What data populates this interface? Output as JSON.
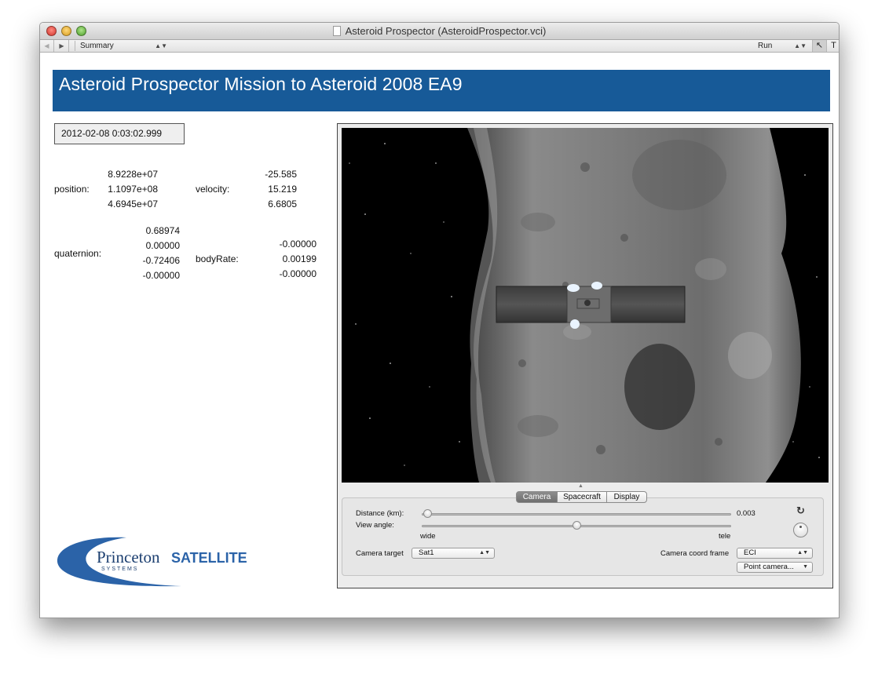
{
  "window": {
    "title": "Asteroid Prospector (AsteroidProspector.vci)"
  },
  "toolbar": {
    "back_glyph": "◀",
    "forward_glyph": "▶",
    "view_popup": "Summary",
    "mode_popup": "Run",
    "arrow_tool": "↖",
    "text_tool": "T"
  },
  "header": {
    "title": "Asteroid Prospector Mission to Asteroid 2008 EA9",
    "background_color": "#175a98"
  },
  "state": {
    "timestamp": "2012-02-08 0:03:02.999",
    "position": {
      "label": "position:",
      "values": [
        "8.9228e+07",
        "1.1097e+08",
        "4.6945e+07"
      ]
    },
    "velocity": {
      "label": "velocity:",
      "values": [
        "-25.585",
        "15.219",
        "6.6805"
      ]
    },
    "quaternion": {
      "label": "quaternion:",
      "values": [
        "0.68974",
        "0.00000",
        "-0.72406",
        "-0.00000"
      ]
    },
    "body_rate": {
      "label": "bodyRate:",
      "values": [
        "-0.00000",
        "0.00199",
        "-0.00000"
      ]
    }
  },
  "viewer": {
    "tabs": [
      "Camera",
      "Spacecraft",
      "Display"
    ],
    "active_tab": "Camera",
    "distance_label": "Distance (km):",
    "distance_value": "0.003",
    "distance_fraction": 0.02,
    "view_angle_label": "View angle:",
    "view_angle_fraction": 0.5,
    "view_angle_min": "wide",
    "view_angle_max": "tele",
    "camera_target_label": "Camera target",
    "camera_target": "Sat1",
    "coord_frame_label": "Camera coord frame",
    "coord_frame": "ECI",
    "point_camera": "Point camera..."
  },
  "logo": {
    "name_part1": "Princeton",
    "name_part2": "SATELLITE",
    "tagline": "SYSTEMS",
    "color": "#2b63a8"
  }
}
